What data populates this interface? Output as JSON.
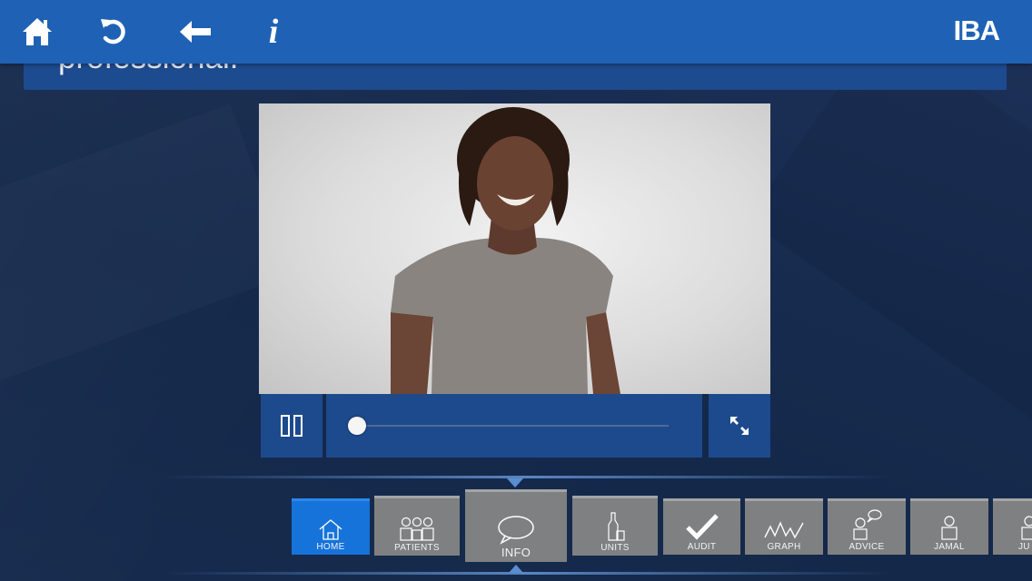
{
  "topbar": {
    "home_icon": "home-icon",
    "refresh_icon": "refresh-icon",
    "back_icon": "back-arrow-icon",
    "info_label": "i",
    "logo": "IBA"
  },
  "panel": {
    "text": "professional."
  },
  "video": {
    "progress": 0.0,
    "pause_icon": "pause-icon",
    "fullscreen_icon": "fullscreen-icon"
  },
  "dock": {
    "items": [
      {
        "label": "HOME",
        "icon": "home-outline-icon"
      },
      {
        "label": "PATIENTS",
        "icon": "patients-icon"
      },
      {
        "label": "INFO",
        "icon": "speech-bubble-icon"
      },
      {
        "label": "UNITS",
        "icon": "bottle-glass-icon"
      },
      {
        "label": "AUDIT",
        "icon": "checkmark-icon"
      },
      {
        "label": "GRAPH",
        "icon": "graph-icon"
      },
      {
        "label": "ADVICE",
        "icon": "advice-icon"
      },
      {
        "label": "JAMAL",
        "icon": "person-icon"
      },
      {
        "label": "JU",
        "icon": "person-icon"
      }
    ]
  },
  "colors": {
    "topbar": "#1f62b5",
    "active_tab": "#1673d9",
    "control": "#1d4a8c"
  }
}
